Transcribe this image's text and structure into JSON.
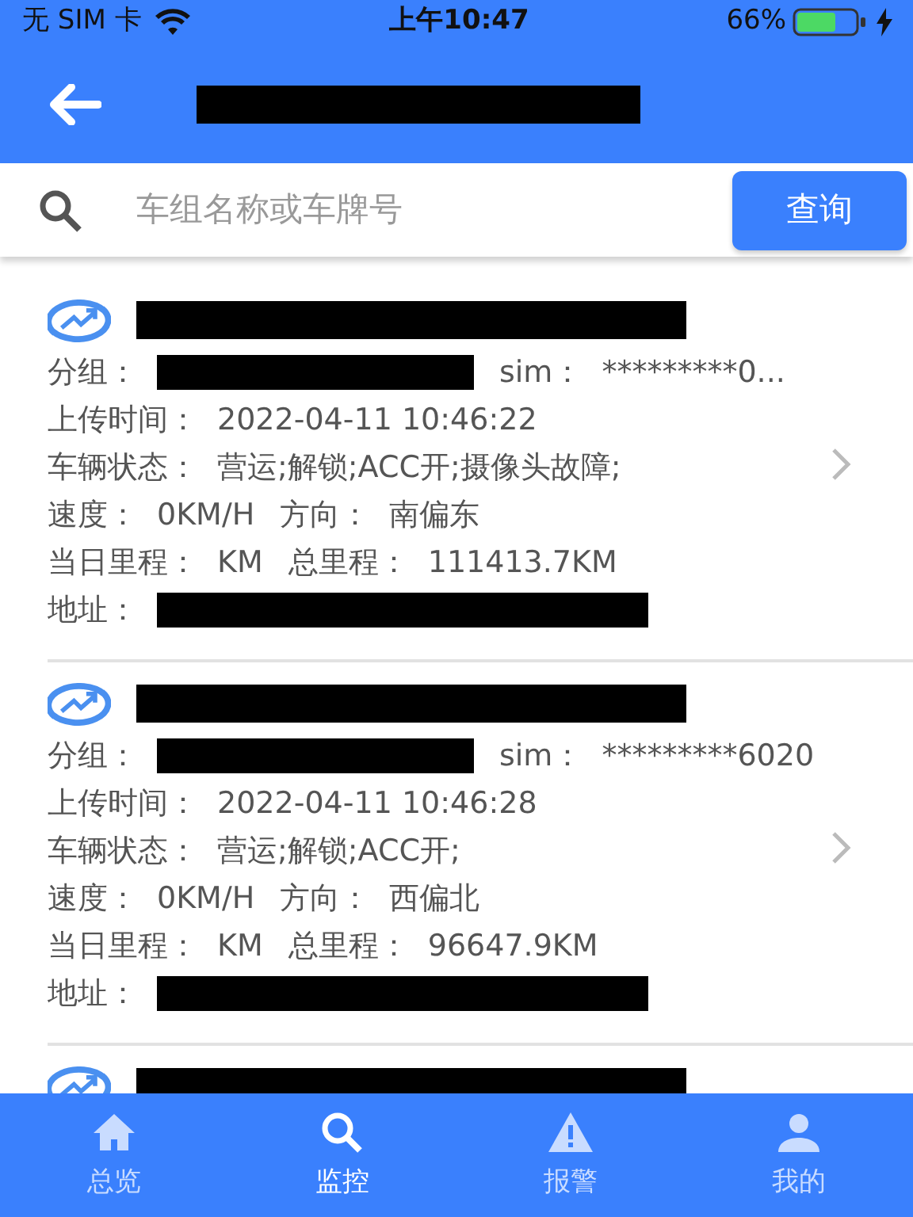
{
  "status_bar": {
    "carrier": "无 SIM 卡",
    "time": "上午10:47",
    "battery": "66%"
  },
  "search": {
    "placeholder": "车组名称或车牌号",
    "button": "查询"
  },
  "vehicles": [
    {
      "chevron": true,
      "rows": [
        [
          {
            "kind": "label",
            "text": "分组："
          },
          {
            "kind": "redacted"
          },
          {
            "kind": "label",
            "text": "sim："
          },
          {
            "kind": "value",
            "text": "*********0..."
          }
        ],
        [
          {
            "kind": "label",
            "text": "上传时间："
          },
          {
            "kind": "value",
            "text": "2022-04-11 10:46:22"
          }
        ],
        [
          {
            "kind": "label",
            "text": "车辆状态："
          },
          {
            "kind": "value",
            "text": "营运;解锁;ACC开;摄像头故障;"
          }
        ],
        [
          {
            "kind": "label",
            "text": "速度："
          },
          {
            "kind": "value",
            "text": "0KM/H"
          },
          {
            "kind": "label",
            "text": "方向："
          },
          {
            "kind": "value",
            "text": "南偏东"
          }
        ],
        [
          {
            "kind": "label",
            "text": "当日里程："
          },
          {
            "kind": "value",
            "text": "KM"
          },
          {
            "kind": "label",
            "text": "总里程："
          },
          {
            "kind": "value",
            "text": "111413.7KM"
          }
        ],
        [
          {
            "kind": "label",
            "text": "地址："
          },
          {
            "kind": "redacted"
          }
        ]
      ]
    },
    {
      "chevron": true,
      "rows": [
        [
          {
            "kind": "label",
            "text": "分组："
          },
          {
            "kind": "redacted"
          },
          {
            "kind": "label",
            "text": "sim："
          },
          {
            "kind": "value",
            "text": "*********6020"
          }
        ],
        [
          {
            "kind": "label",
            "text": "上传时间："
          },
          {
            "kind": "value",
            "text": "2022-04-11 10:46:28"
          }
        ],
        [
          {
            "kind": "label",
            "text": "车辆状态："
          },
          {
            "kind": "value",
            "text": "营运;解锁;ACC开;"
          }
        ],
        [
          {
            "kind": "label",
            "text": "速度："
          },
          {
            "kind": "value",
            "text": "0KM/H"
          },
          {
            "kind": "label",
            "text": "方向："
          },
          {
            "kind": "value",
            "text": "西偏北"
          }
        ],
        [
          {
            "kind": "label",
            "text": "当日里程："
          },
          {
            "kind": "value",
            "text": "KM"
          },
          {
            "kind": "label",
            "text": "总里程："
          },
          {
            "kind": "value",
            "text": "96647.9KM"
          }
        ],
        [
          {
            "kind": "label",
            "text": "地址："
          },
          {
            "kind": "redacted"
          }
        ]
      ]
    },
    {
      "chevron": false
    }
  ],
  "tabs": [
    {
      "label": "总览",
      "selected": false
    },
    {
      "label": "监控",
      "selected": true
    },
    {
      "label": "报警",
      "selected": false
    },
    {
      "label": "我的",
      "selected": false
    }
  ]
}
